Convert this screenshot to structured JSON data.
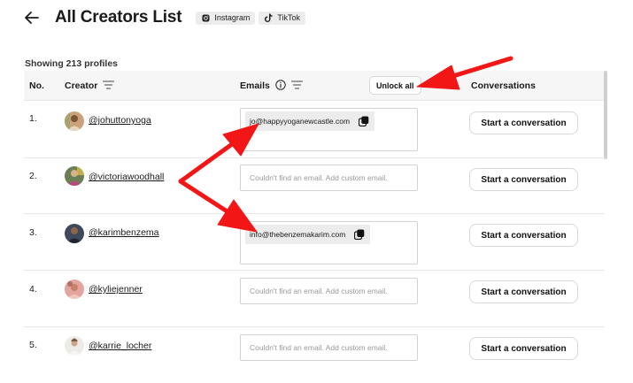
{
  "header": {
    "title": "All Creators List",
    "platforms": [
      {
        "label": "Instagram",
        "icon": "instagram-icon"
      },
      {
        "label": "TikTok",
        "icon": "tiktok-icon"
      }
    ]
  },
  "profiles_count_text": "Showing 213 profiles",
  "table": {
    "columns": {
      "no": "No.",
      "creator": "Creator",
      "emails": "Emails",
      "conversations": "Conversations"
    },
    "unlock_label": "Unlock all",
    "rows": [
      {
        "no": "1.",
        "handle": "@johuttonyoga",
        "email": "jo@happyyoganewcastle.com",
        "conversation_label": "Start a conversation"
      },
      {
        "no": "2.",
        "handle": "@victoriawoodhall",
        "email_placeholder": "Couldn't find an email. Add custom email.",
        "conversation_label": "Start a conversation"
      },
      {
        "no": "3.",
        "handle": "@karimbenzema",
        "email": "info@thebenzemakarim.com",
        "conversation_label": "Start a conversation"
      },
      {
        "no": "4.",
        "handle": "@kyliejenner",
        "email_placeholder": "Couldn't find an email. Add custom email.",
        "conversation_label": "Start a conversation"
      },
      {
        "no": "5.",
        "handle": "@karrie_locher",
        "email_placeholder": "Couldn't find an email. Add custom email.",
        "conversation_label": "Start a conversation"
      }
    ]
  },
  "colors": {
    "annotation_arrow": "#f21616",
    "chip_bg": "#ececec",
    "header_bg": "#f6f6f6"
  }
}
